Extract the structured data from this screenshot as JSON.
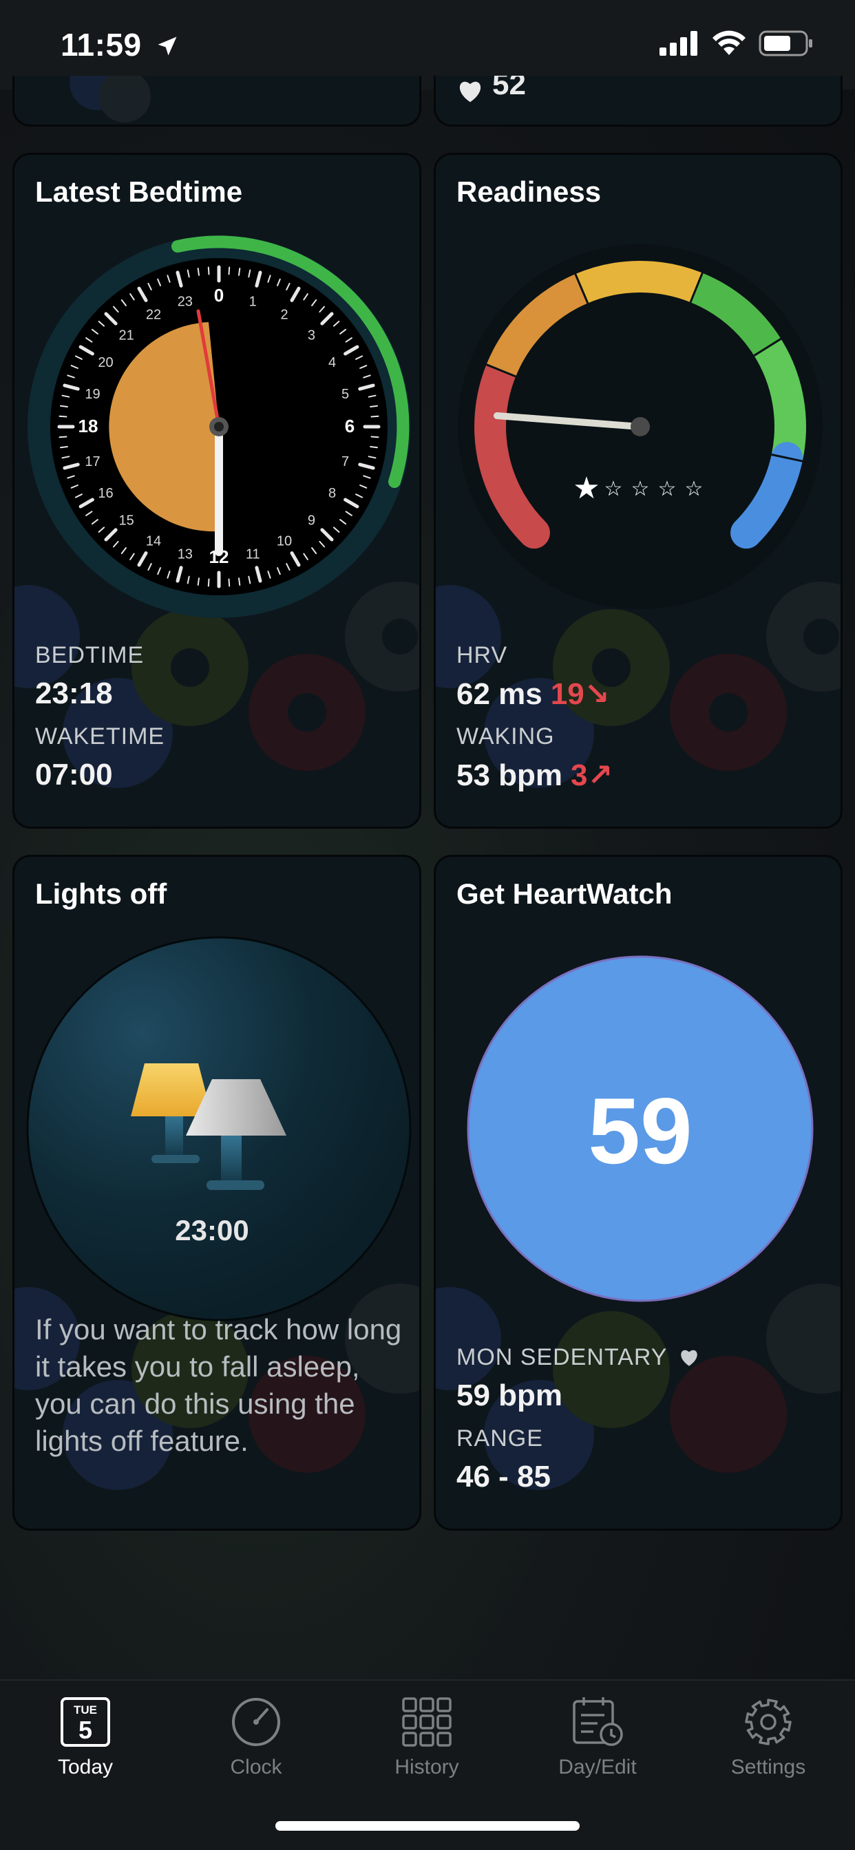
{
  "status": {
    "time": "11:59"
  },
  "top_partial": {
    "right_value": "52"
  },
  "bedtime_card": {
    "title": "Latest Bedtime",
    "hour_labels": [
      "0",
      "1",
      "2",
      "3",
      "4",
      "5",
      "6",
      "7",
      "8",
      "9",
      "10",
      "11",
      "12",
      "13",
      "14",
      "15",
      "16",
      "17",
      "18",
      "19",
      "20",
      "21",
      "22",
      "23"
    ],
    "bedtime_label": "BEDTIME",
    "bedtime_value": "23:18",
    "waketime_label": "WAKETIME",
    "waketime_value": "07:00"
  },
  "readiness_card": {
    "title": "Readiness",
    "stars": 1,
    "stars_max": 5,
    "hrv_label": "HRV",
    "hrv_value": "62 ms",
    "hrv_delta": "19↘",
    "waking_label": "WAKING",
    "waking_value": "53 bpm",
    "waking_delta": "3↗"
  },
  "lights_card": {
    "title": "Lights off",
    "time": "23:00",
    "description": "If you want to track how long it takes you to fall asleep, you can do this using the lights off feature."
  },
  "heartwatch_card": {
    "title": "Get HeartWatch",
    "big_value": "59",
    "sedentary_label": "MON SEDENTARY",
    "sedentary_value": "59 bpm",
    "range_label": "RANGE",
    "range_value": "46 - 85"
  },
  "tabs": [
    {
      "label": "Today",
      "day": "TUE",
      "date": "5",
      "icon": "calendar-today-icon",
      "active": true
    },
    {
      "label": "Clock",
      "icon": "clock-gauge-icon",
      "active": false
    },
    {
      "label": "History",
      "icon": "grid-icon",
      "active": false
    },
    {
      "label": "Day/Edit",
      "icon": "calendar-clock-icon",
      "active": false
    },
    {
      "label": "Settings",
      "icon": "gear-icon",
      "active": false
    }
  ],
  "colors": {
    "card_bg": "#0d161b",
    "bedtime_wedge": "#d99540",
    "clock_arc": "#3fb548",
    "hand_red": "#e23b3b",
    "gauge_red": "#c84a4a",
    "gauge_orange": "#d9923a",
    "gauge_yellow": "#e6b43a",
    "gauge_green": "#4fb84a",
    "gauge_lightgreen": "#5fc858",
    "gauge_blue": "#4a8ee0",
    "heart_circle": "#5b9ae6",
    "delta_red": "#e4474e"
  }
}
